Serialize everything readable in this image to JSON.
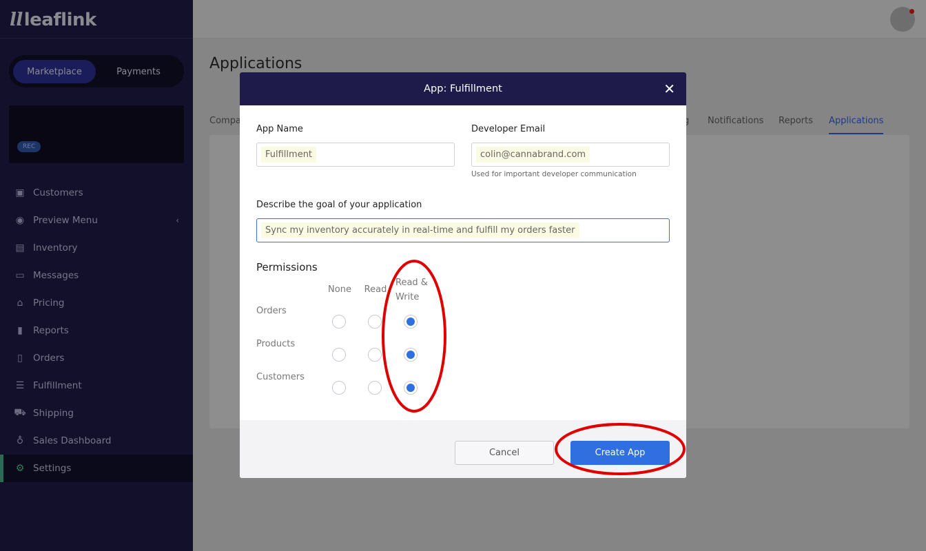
{
  "sidebar": {
    "logo": "leaflink",
    "toggle": {
      "marketplace": "Marketplace",
      "payments": "Payments"
    },
    "badge": "REC",
    "items": [
      {
        "label": "Customers",
        "icon": "contact-icon"
      },
      {
        "label": "Preview Menu",
        "icon": "eye-icon"
      },
      {
        "label": "Inventory",
        "icon": "clipboard-icon"
      },
      {
        "label": "Messages",
        "icon": "message-icon"
      },
      {
        "label": "Pricing",
        "icon": "tag-icon"
      },
      {
        "label": "Reports",
        "icon": "bar-chart-icon"
      },
      {
        "label": "Orders",
        "icon": "document-icon"
      },
      {
        "label": "Fulfillment",
        "icon": "list-icon"
      },
      {
        "label": "Shipping",
        "icon": "truck-icon"
      },
      {
        "label": "Sales Dashboard",
        "icon": "lightbulb-icon"
      },
      {
        "label": "Settings",
        "icon": "gear-icon",
        "active": true
      }
    ]
  },
  "page": {
    "title": "Applications",
    "tabs": [
      "Compa",
      "g",
      "Notifications",
      "Reports",
      "Applications"
    ],
    "active_tab": "Applications"
  },
  "modal": {
    "title": "App: Fulfillment",
    "app_name_label": "App Name",
    "app_name_value": "Fulfillment",
    "email_label": "Developer Email",
    "email_value": "colin@cannabrand.com",
    "email_help": "Used for important developer communication",
    "goal_label": "Describe the goal of your application",
    "goal_value": "Sync my inventory accurately in real-time and fulfill my orders faster",
    "permissions_label": "Permissions",
    "columns": [
      "None",
      "Read",
      "Read &\nWrite"
    ],
    "rows": [
      {
        "label": "Orders",
        "selected": "Read & Write"
      },
      {
        "label": "Products",
        "selected": "Read & Write"
      },
      {
        "label": "Customers",
        "selected": "Read & Write"
      }
    ],
    "cancel": "Cancel",
    "create": "Create App"
  },
  "colors": {
    "accent": "#2f6fe0",
    "modal_header": "#1e1b4b",
    "annotation": "#e00000"
  }
}
